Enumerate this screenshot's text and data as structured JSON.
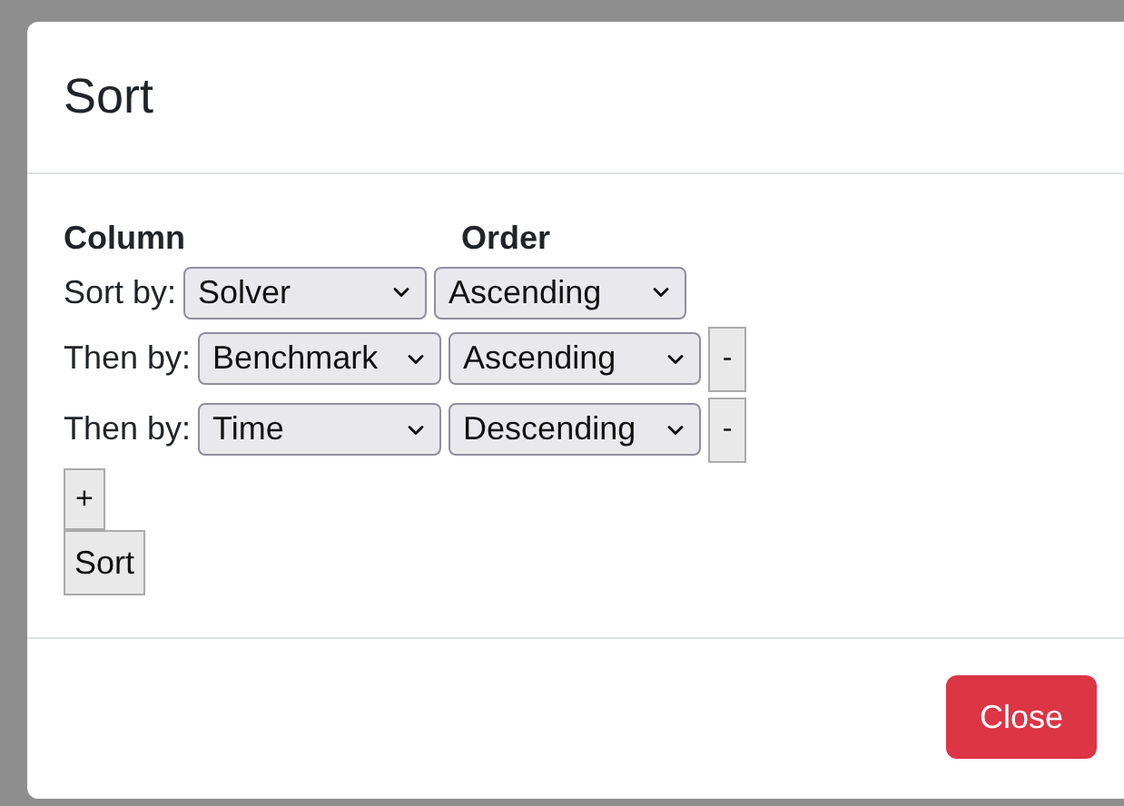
{
  "dialog": {
    "title": "Sort",
    "headers": {
      "column": "Column",
      "order": "Order"
    },
    "rows": [
      {
        "label": "Sort by:",
        "column": "Solver",
        "order": "Ascending",
        "removable": false
      },
      {
        "label": "Then by:",
        "column": "Benchmark",
        "order": "Ascending",
        "removable": true,
        "remove": "-"
      },
      {
        "label": "Then by:",
        "column": "Time",
        "order": "Descending",
        "removable": true,
        "remove": "-"
      }
    ],
    "add_button": "+",
    "sort_button": "Sort",
    "close_button": "Close"
  }
}
